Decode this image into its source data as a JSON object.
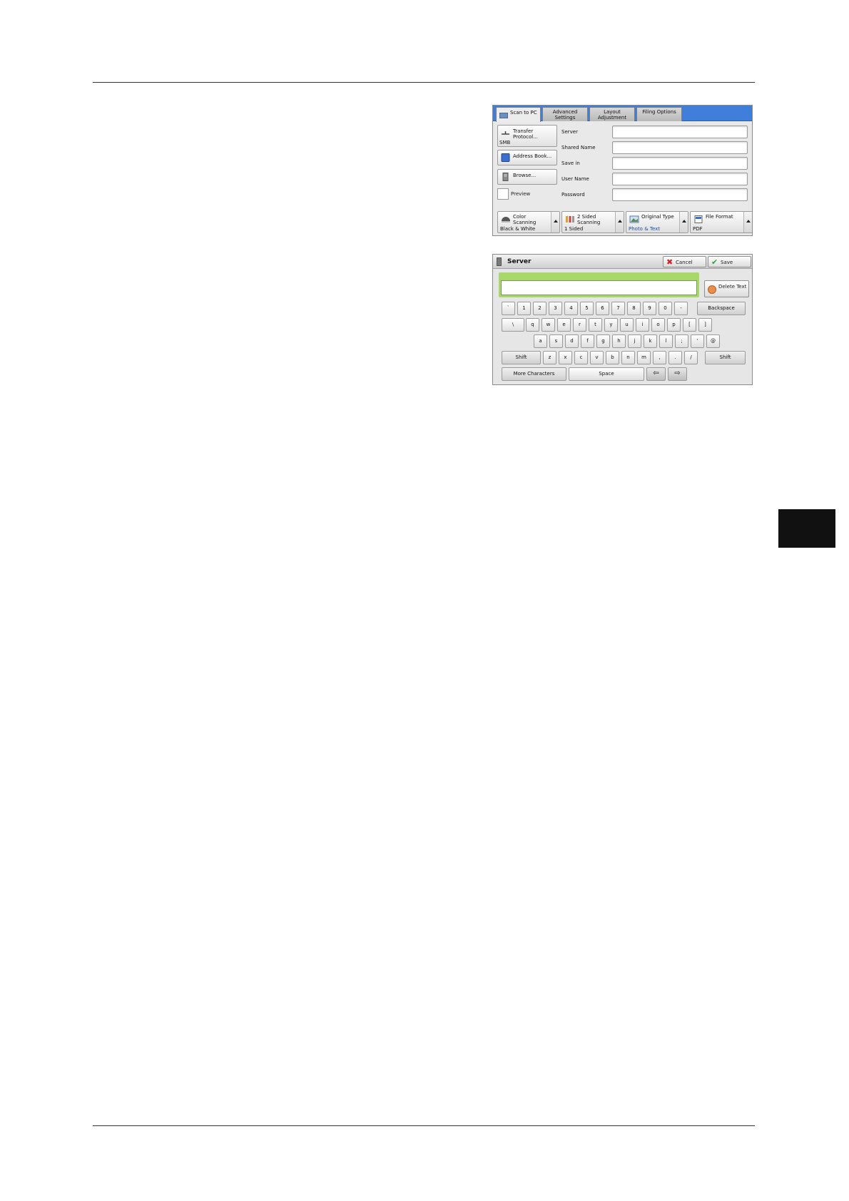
{
  "panel_scan": {
    "tabs": [
      {
        "label": "Scan to PC"
      },
      {
        "label": "Advanced\nSettings"
      },
      {
        "label": "Layout\nAdjustment"
      },
      {
        "label": "Filing Options"
      }
    ],
    "transfer_protocol": {
      "label": "Transfer\nProtocol...",
      "value": "SMB"
    },
    "address_book": "Address Book...",
    "browse": "Browse...",
    "preview": "Preview",
    "fields": [
      {
        "label": "Server"
      },
      {
        "label": "Shared Name"
      },
      {
        "label": "Save in"
      },
      {
        "label": "User Name"
      },
      {
        "label": "Password"
      }
    ],
    "features": [
      {
        "label": "Color\nScanning",
        "value": "Black & White",
        "icon": "color-mode-icon"
      },
      {
        "label": "2 Sided\nScanning",
        "value": "1 Sided",
        "icon": "two-sided-icon"
      },
      {
        "label": "Original Type",
        "value": "Photo & Text",
        "icon": "original-type-icon"
      },
      {
        "label": "File Format",
        "value": "PDF",
        "icon": "file-format-icon"
      }
    ]
  },
  "panel_server": {
    "title": "Server",
    "cancel": "Cancel",
    "save": "Save",
    "delete_text": "Delete Text",
    "rows": [
      [
        "`",
        "1",
        "2",
        "3",
        "4",
        "5",
        "6",
        "7",
        "8",
        "9",
        "0",
        "-"
      ],
      [
        "\\",
        "q",
        "w",
        "e",
        "r",
        "t",
        "y",
        "u",
        "i",
        "o",
        "p",
        "[",
        "]"
      ],
      [
        "a",
        "s",
        "d",
        "f",
        "g",
        "h",
        "j",
        "k",
        "l",
        ";",
        "'",
        "@"
      ],
      [
        "z",
        "x",
        "c",
        "v",
        "b",
        "n",
        "m",
        ",",
        ".",
        "/"
      ]
    ],
    "backspace": "Backspace",
    "shift": "Shift",
    "more_characters": "More Characters",
    "space": "Space",
    "left_arrow": "⇦",
    "right_arrow": "⇨"
  }
}
